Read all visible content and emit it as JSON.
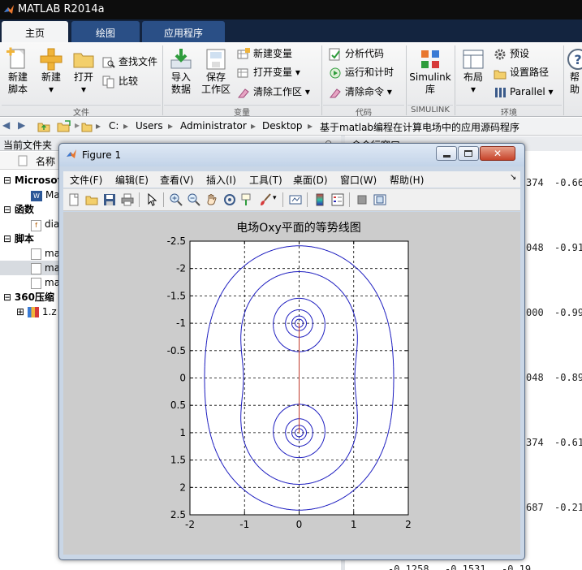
{
  "window": {
    "title": "MATLAB R2014a"
  },
  "ribbon_tabs": [
    "主页",
    "绘图",
    "应用程序"
  ],
  "ribbon": {
    "new_script": [
      "新建",
      "脚本"
    ],
    "new": "新建",
    "open": "打开",
    "find_files": "查找文件",
    "compare": "比较",
    "group_file": "文件",
    "import": [
      "导入",
      "数据"
    ],
    "save_ws": [
      "保存",
      "工作区"
    ],
    "new_var": "新建变量",
    "open_var": "打开变量",
    "clear_ws": "清除工作区",
    "group_variable": "变量",
    "analyze": "分析代码",
    "run_time": "运行和计时",
    "clear_cmd": "清除命令",
    "group_code": "代码",
    "simulink": [
      "Simulink",
      "库"
    ],
    "group_simulink": "SIMULINK",
    "layout": "布局",
    "prefs": "预设",
    "set_path": "设置路径",
    "parallel": "Parallel",
    "group_env": "环境",
    "help": "帮助"
  },
  "address": {
    "segments": [
      "C:",
      "Users",
      "Administrator",
      "Desktop",
      "基于matlab编程在计算电场中的应用源码程序"
    ]
  },
  "current_folder": {
    "header": "当前文件夹",
    "col_name": "名称",
    "groups": [
      {
        "label": "Microsof",
        "items": [
          "Ma"
        ]
      },
      {
        "label": "函数",
        "items": [
          "dia"
        ]
      },
      {
        "label": "脚本",
        "items": [
          "ma",
          "ma",
          "ma"
        ]
      },
      {
        "label": "360压缩 2",
        "items": [
          "1.z"
        ]
      }
    ]
  },
  "command_window": {
    "header": "命令行窗口",
    "col1": [
      "374",
      "048",
      "000",
      "048",
      "374",
      "687"
    ],
    "col2": [
      "-0.66",
      "-0.91",
      "-0.99",
      "-0.89",
      "-0.61",
      "-0.21"
    ],
    "bottom": [
      "-0.1258",
      "-0.1531",
      "-0.19"
    ]
  },
  "figure": {
    "title": "Figure 1",
    "menu": [
      "文件(F)",
      "编辑(E)",
      "查看(V)",
      "插入(I)",
      "工具(T)",
      "桌面(D)",
      "窗口(W)",
      "帮助(H)"
    ]
  },
  "chart_data": {
    "type": "contour",
    "title": "电场Oxy平面的等势线图",
    "xlabel": "",
    "ylabel": "",
    "xlim": [
      -2,
      2
    ],
    "ylim": [
      2.5,
      -2.5
    ],
    "y_axis_reversed": true,
    "grid": true,
    "grid_style": "dashed",
    "x_ticks": [
      -2,
      -1,
      0,
      1,
      2
    ],
    "y_ticks": [
      -2.5,
      -2,
      -1.5,
      -1,
      -0.5,
      0,
      0.5,
      1,
      1.5,
      2,
      2.5
    ],
    "charges": [
      {
        "x": 0,
        "y": -1
      },
      {
        "x": 0,
        "y": 1
      }
    ],
    "contour_levels": [
      0.6,
      1.0,
      1.4,
      2.6,
      4.5,
      8,
      14
    ],
    "separatrix_level": 1.0,
    "line_color": "#1b1bbf",
    "axis_line": {
      "x": 0,
      "from_y": -1,
      "to_y": 1,
      "color": "#c0392b"
    }
  }
}
